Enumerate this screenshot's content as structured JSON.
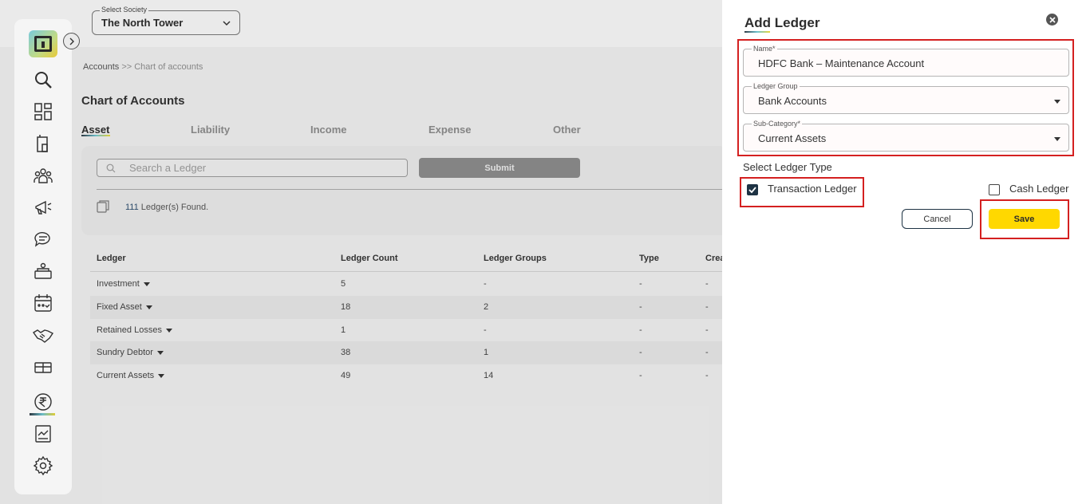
{
  "header": {
    "society_label": "Select Society",
    "society_value": "The North Tower"
  },
  "sidebar": {
    "items": [
      {
        "icon": "search-icon"
      },
      {
        "icon": "dashboard-icon"
      },
      {
        "icon": "building-icon"
      },
      {
        "icon": "members-icon"
      },
      {
        "icon": "announcement-icon"
      },
      {
        "icon": "chat-icon"
      },
      {
        "icon": "amenities-icon"
      },
      {
        "icon": "calendar-icon"
      },
      {
        "icon": "handshake-icon"
      },
      {
        "icon": "gift-icon"
      },
      {
        "icon": "rupee-icon",
        "active": true
      },
      {
        "icon": "reports-icon"
      },
      {
        "icon": "settings-icon"
      }
    ]
  },
  "breadcrumb": {
    "part1": "Accounts",
    "part2": ">> Chart of accounts"
  },
  "page": {
    "title": "Chart of Accounts"
  },
  "tabs": [
    {
      "label": "Asset",
      "active": true
    },
    {
      "label": "Liability"
    },
    {
      "label": "Income"
    },
    {
      "label": "Expense"
    },
    {
      "label": "Other"
    }
  ],
  "filter": {
    "search_placeholder": "Search a Ledger",
    "submit_label": "Submit",
    "found_count": "111",
    "found_suffix": "Ledger(s) Found."
  },
  "table": {
    "headers": [
      "Ledger",
      "Ledger Count",
      "Ledger Groups",
      "Type",
      "Crea"
    ],
    "rows": [
      {
        "ledger": "Investment",
        "count": "5",
        "groups": "-",
        "type": "-",
        "created": "-"
      },
      {
        "ledger": "Fixed Asset",
        "count": "18",
        "groups": "2",
        "type": "-",
        "created": "-"
      },
      {
        "ledger": "Retained Losses",
        "count": "1",
        "groups": "-",
        "type": "-",
        "created": "-"
      },
      {
        "ledger": "Sundry Debtor",
        "count": "38",
        "groups": "1",
        "type": "-",
        "created": "-"
      },
      {
        "ledger": "Current Assets",
        "count": "49",
        "groups": "14",
        "type": "-",
        "created": "-"
      }
    ]
  },
  "drawer": {
    "title": "Add Ledger",
    "name_label": "Name*",
    "name_value": "HDFC Bank – Maintenance Account",
    "group_label": "Ledger Group",
    "group_value": "Bank Accounts",
    "subcat_label": "Sub-Category*",
    "subcat_value": "Current Assets",
    "type_label": "Select Ledger Type",
    "transaction_label": "Transaction Ledger",
    "transaction_checked": true,
    "cash_label": "Cash Ledger",
    "cash_checked": false,
    "cancel_label": "Cancel",
    "save_label": "Save"
  },
  "colors": {
    "accent_yellow": "#ffd800",
    "highlight_red": "#d42020",
    "dark_navy": "#1e3344"
  }
}
